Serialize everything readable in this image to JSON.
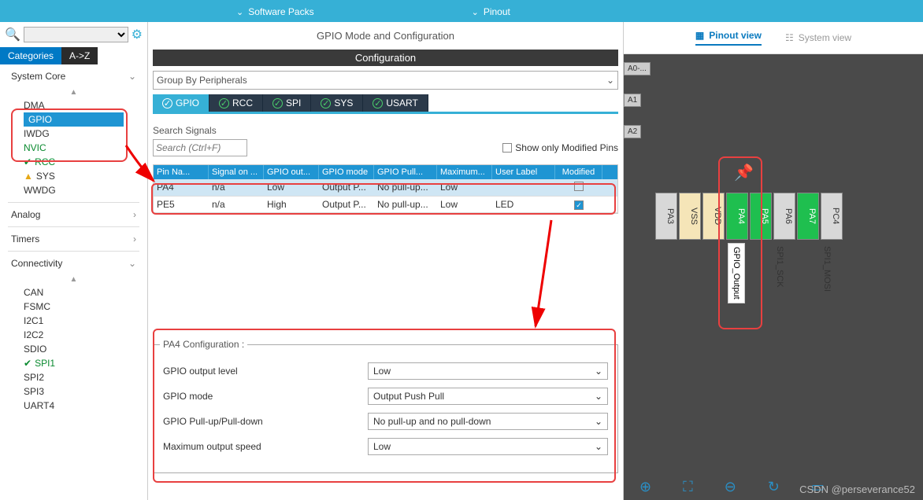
{
  "topbar": {
    "software_packs": "Software Packs",
    "pinout": "Pinout"
  },
  "left": {
    "tabs": {
      "categories": "Categories",
      "az": "A->Z"
    },
    "sections": {
      "system_core": "System Core",
      "analog": "Analog",
      "timers": "Timers",
      "connectivity": "Connectivity"
    },
    "system_items": [
      "DMA",
      "GPIO",
      "IWDG",
      "NVIC",
      "RCC",
      "SYS",
      "WWDG"
    ],
    "conn_items": [
      "CAN",
      "FSMC",
      "I2C1",
      "I2C2",
      "SDIO",
      "SPI1",
      "SPI2",
      "SPI3",
      "UART4"
    ]
  },
  "mid": {
    "title": "GPIO Mode and Configuration",
    "conf_header": "Configuration",
    "group_by": "Group By Peripherals",
    "periph_tabs": [
      "GPIO",
      "RCC",
      "SPI",
      "SYS",
      "USART"
    ],
    "search_label": "Search Signals",
    "search_placeholder": "Search (Ctrl+F)",
    "show_modified": "Show only Modified Pins",
    "headers": [
      "Pin Na...",
      "Signal on ...",
      "GPIO out...",
      "GPIO mode",
      "GPIO Pull...",
      "Maximum...",
      "User Label",
      "Modified"
    ],
    "rows": [
      {
        "pin": "PA4",
        "signal": "n/a",
        "out": "Low",
        "mode": "Output P...",
        "pull": "No pull-up...",
        "speed": "Low",
        "label": "",
        "modified": false
      },
      {
        "pin": "PE5",
        "signal": "n/a",
        "out": "High",
        "mode": "Output P...",
        "pull": "No pull-up...",
        "speed": "Low",
        "label": "LED",
        "modified": true
      }
    ],
    "config": {
      "legend": "PA4 Configuration :",
      "rows": [
        {
          "label": "GPIO output level",
          "value": "Low"
        },
        {
          "label": "GPIO mode",
          "value": "Output Push Pull"
        },
        {
          "label": "GPIO Pull-up/Pull-down",
          "value": "No pull-up and no pull-down"
        },
        {
          "label": "Maximum output speed",
          "value": "Low"
        }
      ]
    }
  },
  "right": {
    "pinout_view": "Pinout view",
    "system_view": "System view",
    "side_pins": [
      "A0-...",
      "A1",
      "A2"
    ],
    "pins": [
      "PA3",
      "VSS",
      "VDD",
      "PA4",
      "PA5",
      "PA6",
      "PA7",
      "PC4"
    ],
    "pin_labels": {
      "pa4": "GPIO_Output",
      "pa5": "SPI1_SCK",
      "pa7": "SPI1_MOSI"
    }
  },
  "watermark": "CSDN @perseverance52"
}
